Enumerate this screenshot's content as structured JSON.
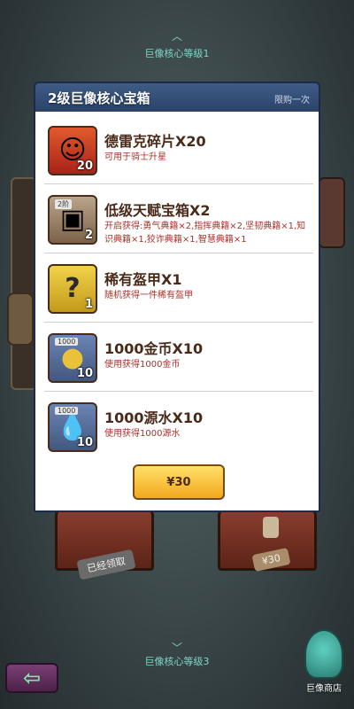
{
  "background": {
    "top_level_label": "巨像核心等级1",
    "bottom_level_label": "巨像核心等级3",
    "claimed_tag": "已经领取",
    "chest_price_tag": "¥30",
    "shop_label": "巨像商店"
  },
  "modal": {
    "title": "2级巨像核心宝箱",
    "limit": "限购一次",
    "items": [
      {
        "name": "德雷克碎片X20",
        "desc": "可用于骑士升星",
        "count": "20",
        "badge": "",
        "icon": "hero-portrait-icon",
        "glyph": "☺"
      },
      {
        "name": "低级天赋宝箱X2",
        "desc": "开启获得:勇气典籍×2,指挥典籍×2,坚韧典籍×1,知识典籍×1,狡诈典籍×1,智慧典籍×1",
        "count": "2",
        "badge": "2阶",
        "icon": "treasure-chest-icon",
        "glyph": "▣"
      },
      {
        "name": "稀有盔甲X1",
        "desc": "随机获得一件稀有盔甲",
        "count": "1",
        "badge": "",
        "icon": "mystery-armor-icon",
        "glyph": "?"
      },
      {
        "name": "1000金币X10",
        "desc": "使用获得1000金币",
        "count": "10",
        "badge": "1000",
        "icon": "gold-coin-icon",
        "glyph": "●"
      },
      {
        "name": "1000源水X10",
        "desc": "使用获得1000源水",
        "count": "10",
        "badge": "1000",
        "icon": "water-drop-icon",
        "glyph": "💧"
      }
    ],
    "price": "¥30"
  },
  "colors": {
    "header": "#2b4368",
    "desc_text": "#a8322a",
    "price_button": "#f2a81c"
  }
}
